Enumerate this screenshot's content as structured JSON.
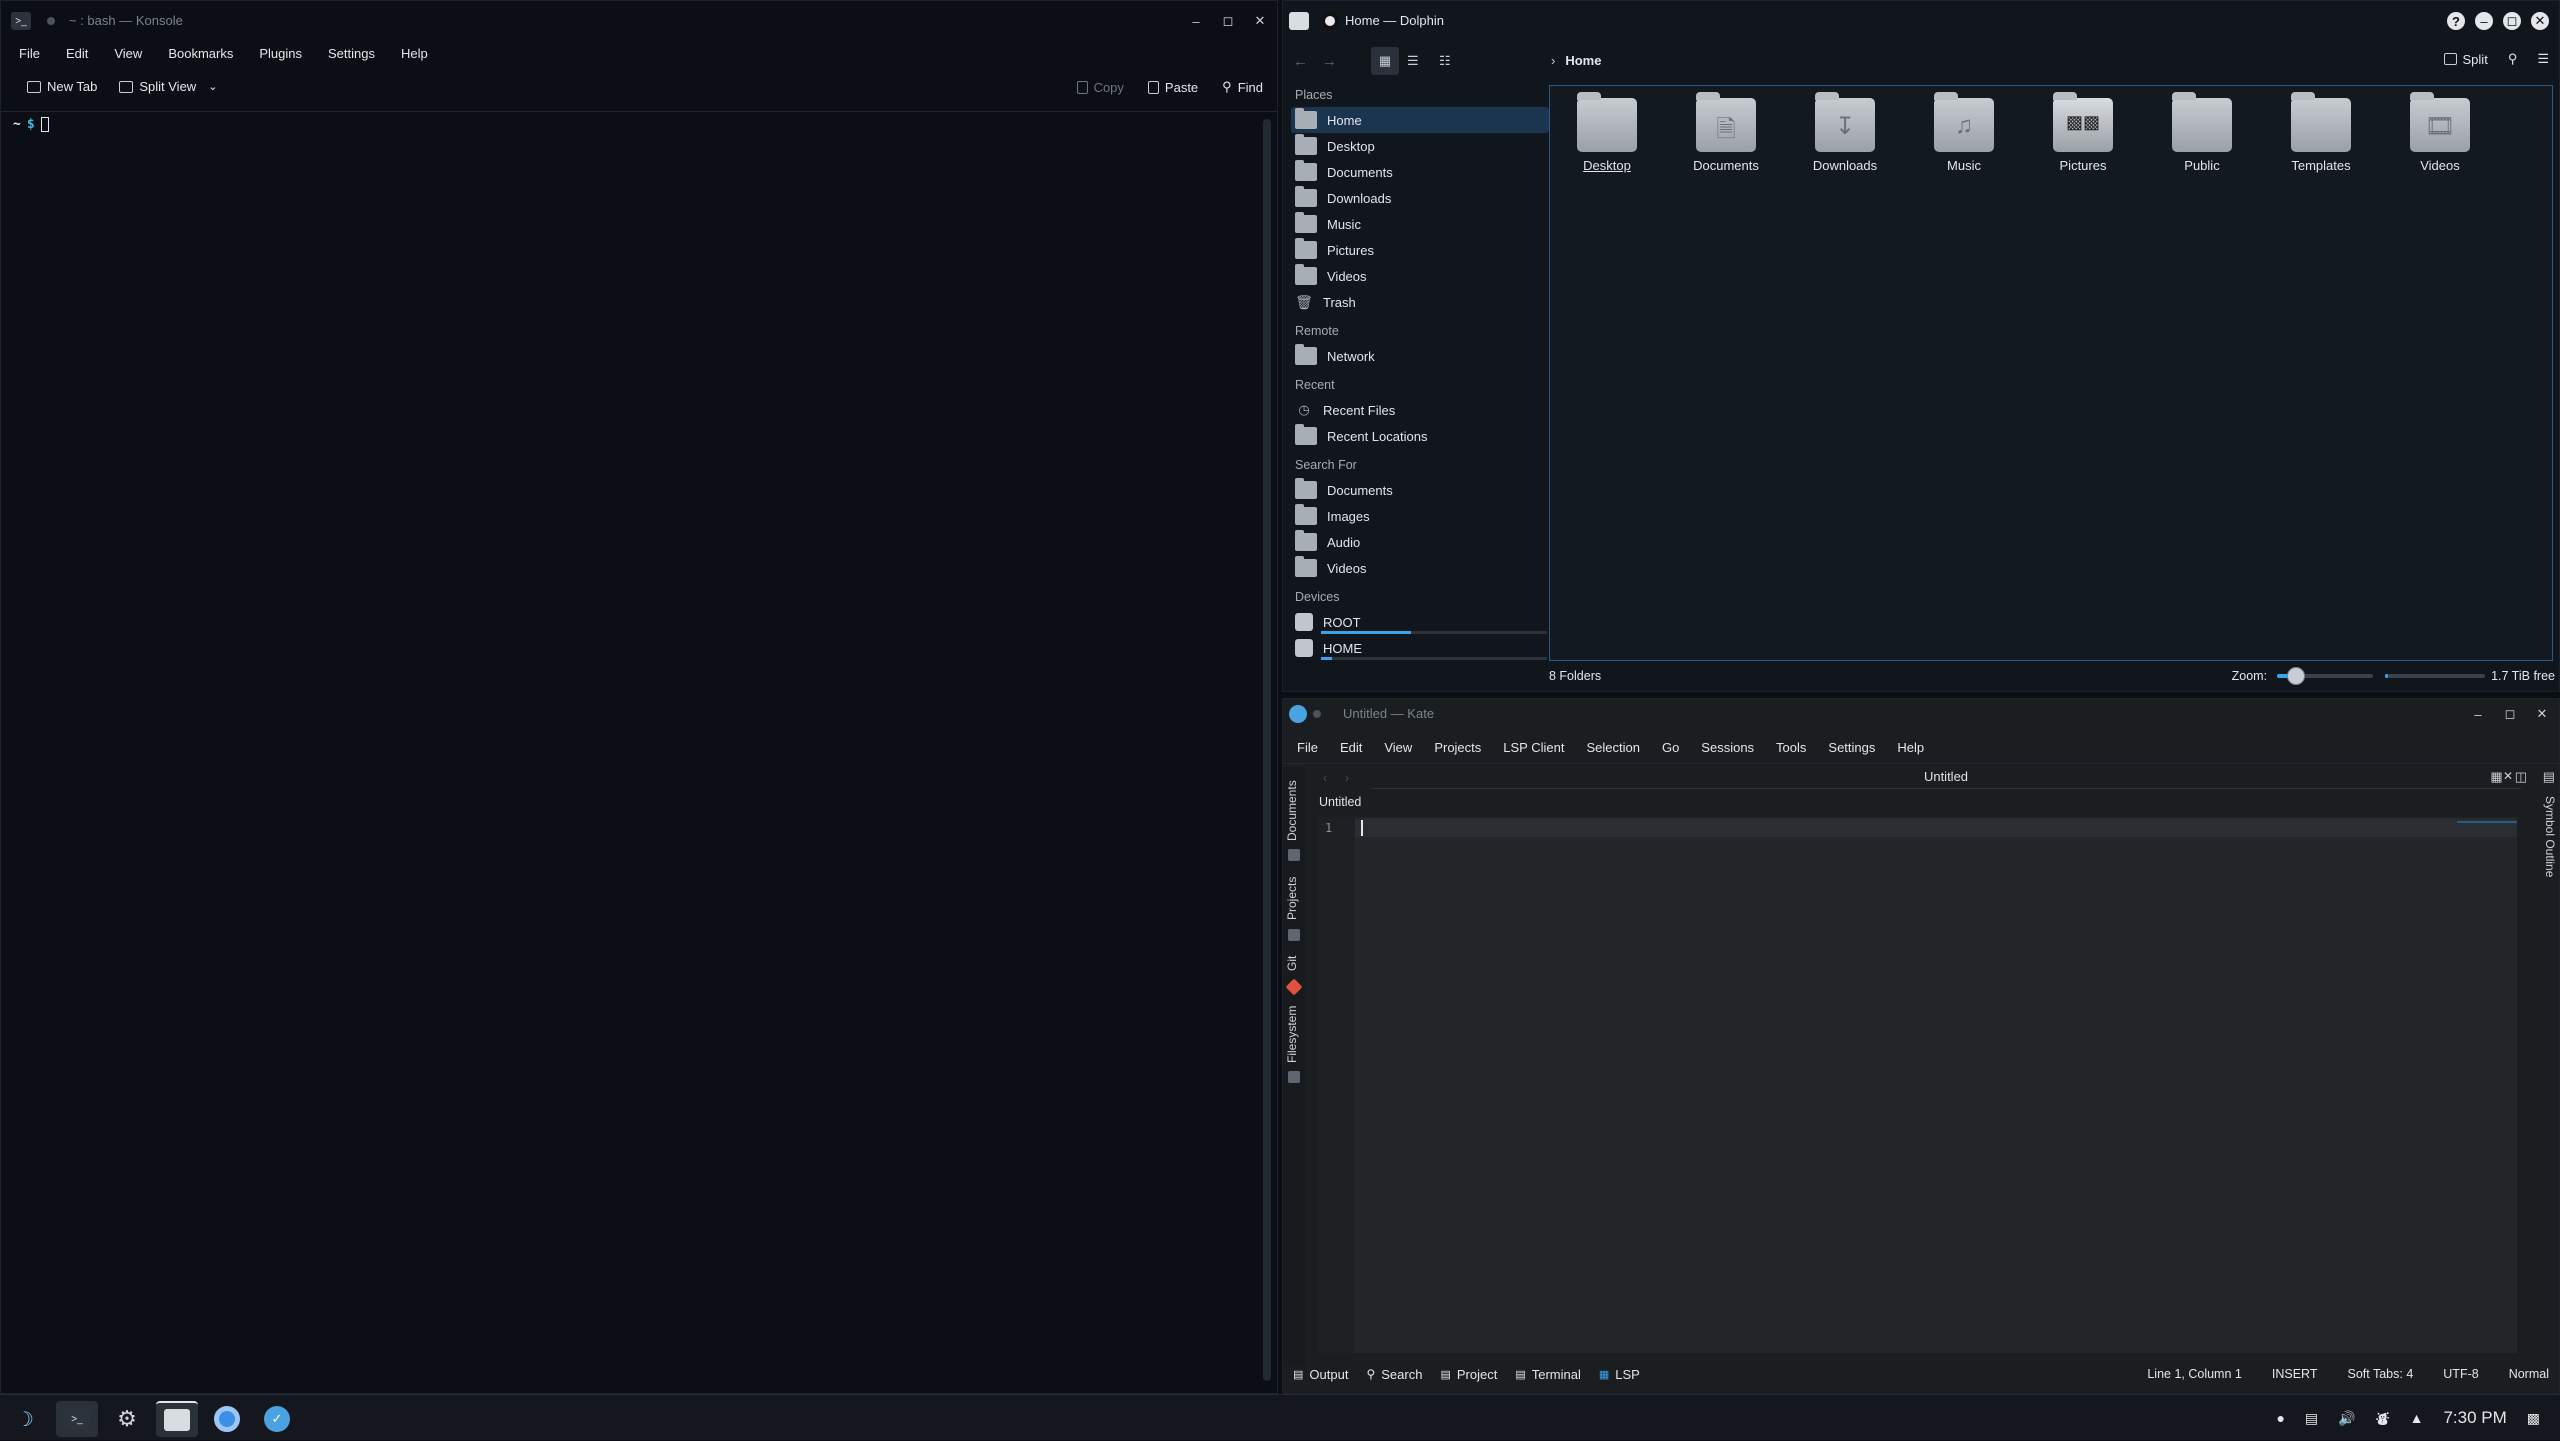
{
  "konsole": {
    "title": "~ : bash — Konsole",
    "menu": [
      "File",
      "Edit",
      "View",
      "Bookmarks",
      "Plugins",
      "Settings",
      "Help"
    ],
    "toolbar": {
      "new_tab": "New Tab",
      "split_view": "Split View",
      "copy": "Copy",
      "paste": "Paste",
      "find": "Find"
    },
    "prompt_dir": "~",
    "prompt_symbol": "$"
  },
  "dolphin": {
    "title": "Home — Dolphin",
    "breadcrumb": "Home",
    "split_label": "Split",
    "places_header": "Places",
    "places": [
      "Home",
      "Desktop",
      "Documents",
      "Downloads",
      "Music",
      "Pictures",
      "Videos",
      "Trash"
    ],
    "remote_header": "Remote",
    "remote": [
      "Network"
    ],
    "recent_header": "Recent",
    "recent": [
      "Recent Files",
      "Recent Locations"
    ],
    "search_header": "Search For",
    "search": [
      "Documents",
      "Images",
      "Audio",
      "Videos"
    ],
    "devices_header": "Devices",
    "devices": [
      {
        "name": "ROOT",
        "used": 0.4
      },
      {
        "name": "HOME",
        "used": 0.05
      }
    ],
    "folders": [
      "Desktop",
      "Documents",
      "Downloads",
      "Music",
      "Pictures",
      "Public",
      "Templates",
      "Videos"
    ],
    "status": {
      "count": "8 Folders",
      "zoom_label": "Zoom:",
      "zoom_level": 0.2,
      "free_space": "1.7 TiB free",
      "free_used": 0.03
    }
  },
  "kate": {
    "title": "Untitled — Kate",
    "menu": [
      "File",
      "Edit",
      "View",
      "Projects",
      "LSP Client",
      "Selection",
      "Go",
      "Sessions",
      "Tools",
      "Settings",
      "Help"
    ],
    "tab_title": "Untitled",
    "breadcrumb": "Untitled",
    "line_number": "1",
    "left_tabs": [
      "Documents",
      "Projects",
      "Git",
      "Filesystem"
    ],
    "right_tab": "Symbol Outline",
    "bottom_tabs": [
      "Output",
      "Search",
      "Project",
      "Terminal",
      "LSP"
    ],
    "status": {
      "position": "Line 1, Column 1",
      "mode": "INSERT",
      "indent": "Soft Tabs: 4",
      "encoding": "UTF-8",
      "input_mode": "Normal"
    }
  },
  "taskbar": {
    "apps": [
      "app-launcher-icon",
      "konsole-icon",
      "settings-icon",
      "dolphin-icon",
      "chromium-icon",
      "kate-icon"
    ],
    "clock": "7:30 PM"
  }
}
